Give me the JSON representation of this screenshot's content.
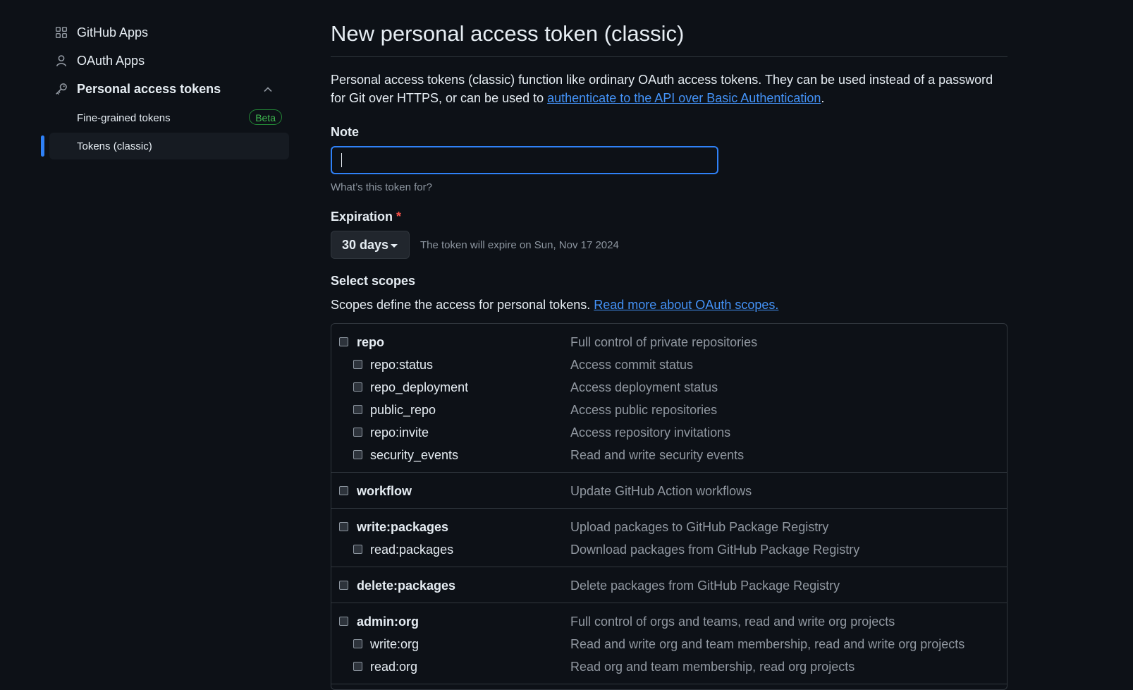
{
  "sidebar": {
    "items": [
      {
        "label": "GitHub Apps",
        "icon": "apps-grid-icon"
      },
      {
        "label": "OAuth Apps",
        "icon": "person-icon"
      },
      {
        "label": "Personal access tokens",
        "icon": "key-icon",
        "expanded": true
      }
    ],
    "sub_items": [
      {
        "label": "Fine-grained tokens",
        "badge": "Beta"
      },
      {
        "label": "Tokens (classic)",
        "selected": true
      }
    ]
  },
  "page": {
    "title": "New personal access token (classic)",
    "intro_text": "Personal access tokens (classic) function like ordinary OAuth access tokens. They can be used instead of a password for Git over HTTPS, or can be used to ",
    "intro_link": "authenticate to the API over Basic Authentication",
    "intro_end": "."
  },
  "note": {
    "label": "Note",
    "value": "",
    "hint": "What’s this token for?"
  },
  "expiration": {
    "label": "Expiration",
    "required_mark": "*",
    "selected": "30 days",
    "info": "The token will expire on Sun, Nov 17 2024"
  },
  "scopes": {
    "heading": "Select scopes",
    "desc_text": "Scopes define the access for personal tokens. ",
    "desc_link": "Read more about OAuth scopes.",
    "groups": [
      {
        "name": "repo",
        "desc": "Full control of private repositories",
        "children": [
          {
            "name": "repo:status",
            "desc": "Access commit status"
          },
          {
            "name": "repo_deployment",
            "desc": "Access deployment status"
          },
          {
            "name": "public_repo",
            "desc": "Access public repositories"
          },
          {
            "name": "repo:invite",
            "desc": "Access repository invitations"
          },
          {
            "name": "security_events",
            "desc": "Read and write security events"
          }
        ]
      },
      {
        "name": "workflow",
        "desc": "Update GitHub Action workflows",
        "children": []
      },
      {
        "name": "write:packages",
        "desc": "Upload packages to GitHub Package Registry",
        "children": [
          {
            "name": "read:packages",
            "desc": "Download packages from GitHub Package Registry"
          }
        ]
      },
      {
        "name": "delete:packages",
        "desc": "Delete packages from GitHub Package Registry",
        "children": []
      },
      {
        "name": "admin:org",
        "desc": "Full control of orgs and teams, read and write org projects",
        "children": [
          {
            "name": "write:org",
            "desc": "Read and write org and team membership, read and write org projects"
          },
          {
            "name": "read:org",
            "desc": "Read org and team membership, read org projects"
          }
        ]
      }
    ]
  },
  "colors": {
    "background": "#0d1117",
    "accent": "#2f81f7",
    "link": "#4493f8",
    "beta_green": "#3fb950",
    "required_red": "#f85149"
  }
}
